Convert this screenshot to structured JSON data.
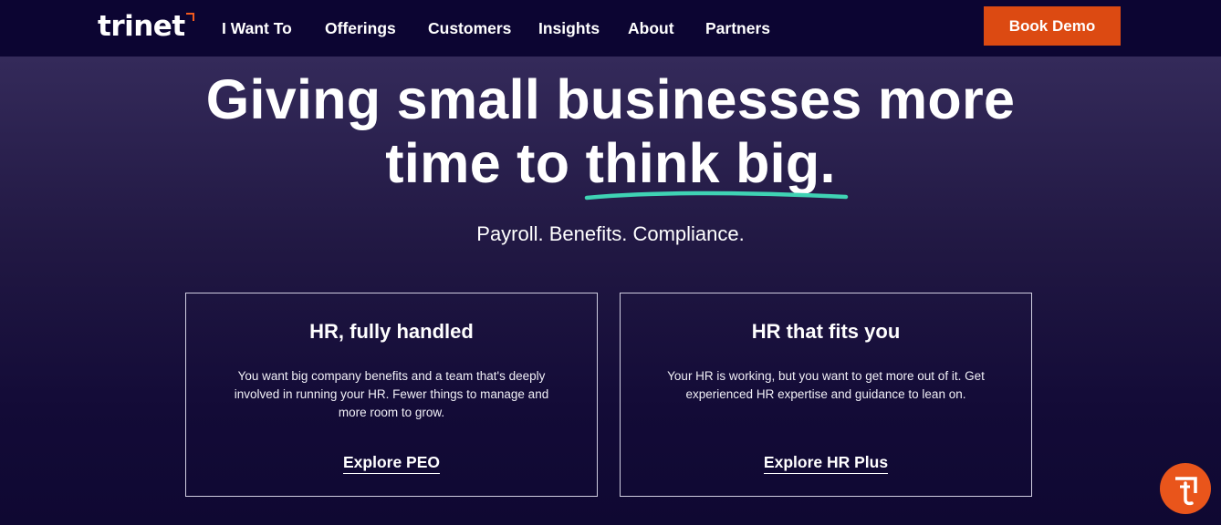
{
  "nav": {
    "logo_text": "trinet",
    "items": [
      "I Want To",
      "Offerings",
      "Customers",
      "Insights",
      "About",
      "Partners"
    ],
    "cta_label": "Book Demo"
  },
  "hero": {
    "headline_line1": "Giving small businesses more",
    "headline_line2_prefix": "time to",
    "headline_emphasis": "think big",
    "headline_period": ".",
    "subheadline": "Payroll. Benefits. Compliance."
  },
  "cards": [
    {
      "title": "HR, fully handled",
      "description": "You want big company benefits and a team that's deeply involved in running your HR. Fewer things to manage and more room to grow.",
      "link_label": "Explore PEO"
    },
    {
      "title": "HR that fits you",
      "description": "Your HR is working, but you want to get more out of it. Get experienced HR expertise and guidance to lean on.",
      "link_label": "Explore HR Plus"
    }
  ],
  "colors": {
    "nav_bg": "#0c0532",
    "accent_orange": "#dc4a12",
    "underline_teal": "#3fd3b4"
  },
  "icons": {
    "chat_widget": "trinet-t-icon"
  }
}
